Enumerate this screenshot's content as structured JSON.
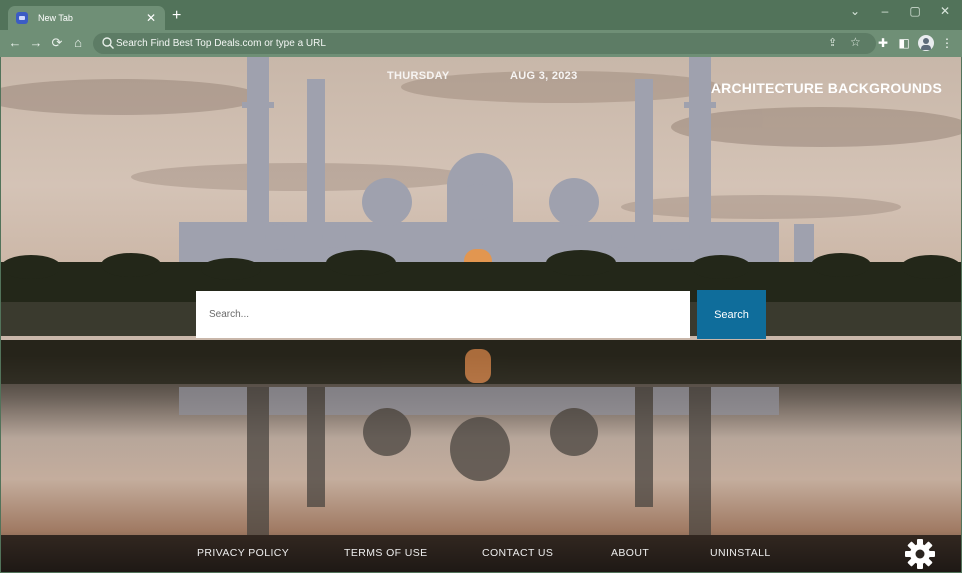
{
  "browser": {
    "tab_title": "New Tab",
    "tab_close_icon": "close-icon",
    "new_tab_icon": "plus-icon",
    "omnibox_placeholder": "Search Find Best Top Deals.com or type a URL",
    "icons": [
      "back-icon",
      "forward-icon",
      "reload-icon",
      "home-icon",
      "search-icon",
      "share-icon",
      "star-icon",
      "extensions-icon",
      "side-panel-icon",
      "profile-icon",
      "menu-icon"
    ],
    "accent_color": "#52735a"
  },
  "page": {
    "day": "THURSDAY",
    "date": "AUG 3, 2023",
    "background_title": "ARCHITECTURE BACKGROUNDS",
    "search": {
      "placeholder": "Search...",
      "value": "",
      "button_label": "Search",
      "button_color": "#0f6d9b"
    },
    "footer": {
      "links": [
        "PRIVACY POLICY",
        "TERMS OF USE",
        "CONTACT US",
        "ABOUT",
        "UNINSTALL"
      ],
      "settings_icon": "gear-icon"
    }
  }
}
